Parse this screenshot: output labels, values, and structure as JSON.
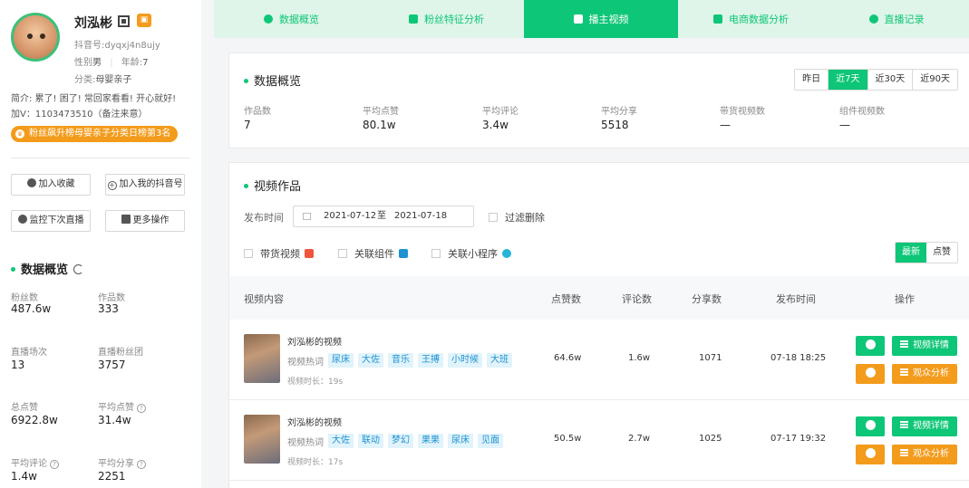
{
  "profile": {
    "name": "刘泓彬",
    "douyin_id": "抖音号:dyqxj4n8ujy",
    "gender_label": "性别",
    "gender": "男",
    "age_label": "年龄:",
    "age": "7",
    "category_label": "分类:",
    "category": "母婴亲子",
    "bio": "简介: 累了! 困了! 常回家看看! 开心就好!",
    "contact": "加V：1103473510（备注来意）",
    "rank_badge": "粉丝飙升榜母婴亲子分类日榜第3名"
  },
  "actions": {
    "favorite": "加入收藏",
    "add_my_account": "加入我的抖音号",
    "monitor_live": "监控下次直播",
    "more": "更多操作"
  },
  "left_stats": {
    "title": "数据概览",
    "items": [
      {
        "label": "粉丝数",
        "value": "487.6w"
      },
      {
        "label": "作品数",
        "value": "333"
      },
      {
        "label": "直播场次",
        "value": "13"
      },
      {
        "label": "直播粉丝团",
        "value": "3757"
      },
      {
        "label": "总点赞",
        "value": "6922.8w"
      },
      {
        "label": "平均点赞",
        "value": "31.4w"
      },
      {
        "label": "平均评论",
        "value": "1.4w"
      },
      {
        "label": "平均分享",
        "value": "2251"
      }
    ]
  },
  "tabs": [
    {
      "label": "数据概览",
      "icon": "pie-chart-icon"
    },
    {
      "label": "粉丝特征分析",
      "icon": "user-card-icon"
    },
    {
      "label": "播主视频",
      "icon": "video-camera-icon"
    },
    {
      "label": "电商数据分析",
      "icon": "shop-icon"
    },
    {
      "label": "直播记录",
      "icon": "clock-icon"
    }
  ],
  "overview": {
    "title": "数据概览",
    "ranges": [
      "昨日",
      "近7天",
      "近30天",
      "近90天"
    ],
    "active_range": "近7天",
    "metrics": [
      {
        "label": "作品数",
        "value": "7"
      },
      {
        "label": "平均点赞",
        "value": "80.1w"
      },
      {
        "label": "平均评论",
        "value": "3.4w"
      },
      {
        "label": "平均分享",
        "value": "5518"
      },
      {
        "label": "带货视频数",
        "value": "—"
      },
      {
        "label": "组件视频数",
        "value": "—"
      }
    ]
  },
  "videos": {
    "title": "视频作品",
    "date_label": "发布时间",
    "date_start": "2021-07-12",
    "date_sep": "至",
    "date_end": "2021-07-18",
    "filter_deleted": "过滤删除",
    "filters": [
      "带货视频",
      "关联组件",
      "关联小程序"
    ],
    "sort": [
      "最新",
      "点赞"
    ],
    "columns": [
      "视频内容",
      "点赞数",
      "评论数",
      "分享数",
      "发布时间",
      "操作"
    ],
    "hot_label": "视频热词",
    "duration_label": "视频时长：",
    "detail_label": "视频详情",
    "audience_label": "观众分析",
    "rows": [
      {
        "title": "刘泓彬的视频",
        "keywords": [
          "尿床",
          "大佐",
          "音乐",
          "王搏",
          "小时候",
          "大班"
        ],
        "duration": "19s",
        "likes": "64.6w",
        "comments": "1.6w",
        "shares": "1071",
        "time": "07-18 18:25"
      },
      {
        "title": "刘泓彬的视频",
        "keywords": [
          "大佐",
          "联动",
          "梦幻",
          "果果",
          "尿床",
          "见面"
        ],
        "duration": "17s",
        "likes": "50.5w",
        "comments": "2.7w",
        "shares": "1025",
        "time": "07-17 19:32"
      }
    ]
  },
  "colors": {
    "accent": "#0ec677",
    "orange": "#f39b1b",
    "tag_bg": "#e1f3fb",
    "tag_text": "#1d93d0"
  }
}
